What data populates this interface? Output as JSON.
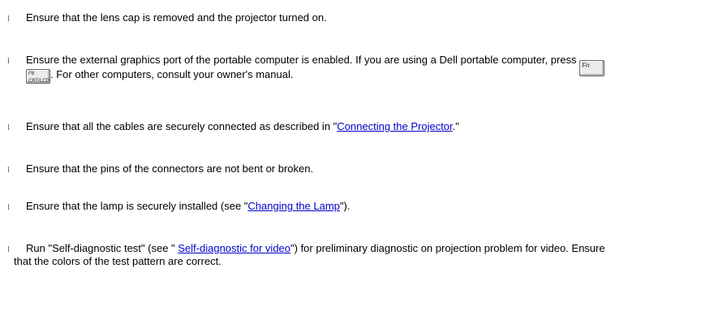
{
  "items": [
    {
      "bullet": "l",
      "text": "Ensure that the lens cap is removed and the projector turned on."
    },
    {
      "bullet": "l",
      "before_key": "Ensure the external graphics port of the portable computer is enabled. If you are using a Dell portable computer, press",
      "key_fn": "Fn",
      "key_f8_top": "F8",
      "key_f8_bottom": "CRT/LCD",
      "after_key": ". For other computers, consult your owner's manual."
    },
    {
      "bullet": "l",
      "before": "Ensure that all the cables are securely connected as described in \"",
      "link": "Connecting the Projector",
      "after": ".\""
    },
    {
      "bullet": "l",
      "text": "Ensure that the pins of the connectors are not bent or broken."
    },
    {
      "bullet": "l",
      "before": "Ensure that the lamp is securely installed (see \"",
      "link": "Changing the Lamp",
      "after": "\")."
    },
    {
      "bullet": "l",
      "before": "Run \"Self-diagnostic test\" (see \" ",
      "link": "Self-diagnostic for video",
      "after_line1": "\") for preliminary diagnostic on projection problem for video. Ensure",
      "line2": "that the colors of the test pattern are correct."
    }
  ]
}
